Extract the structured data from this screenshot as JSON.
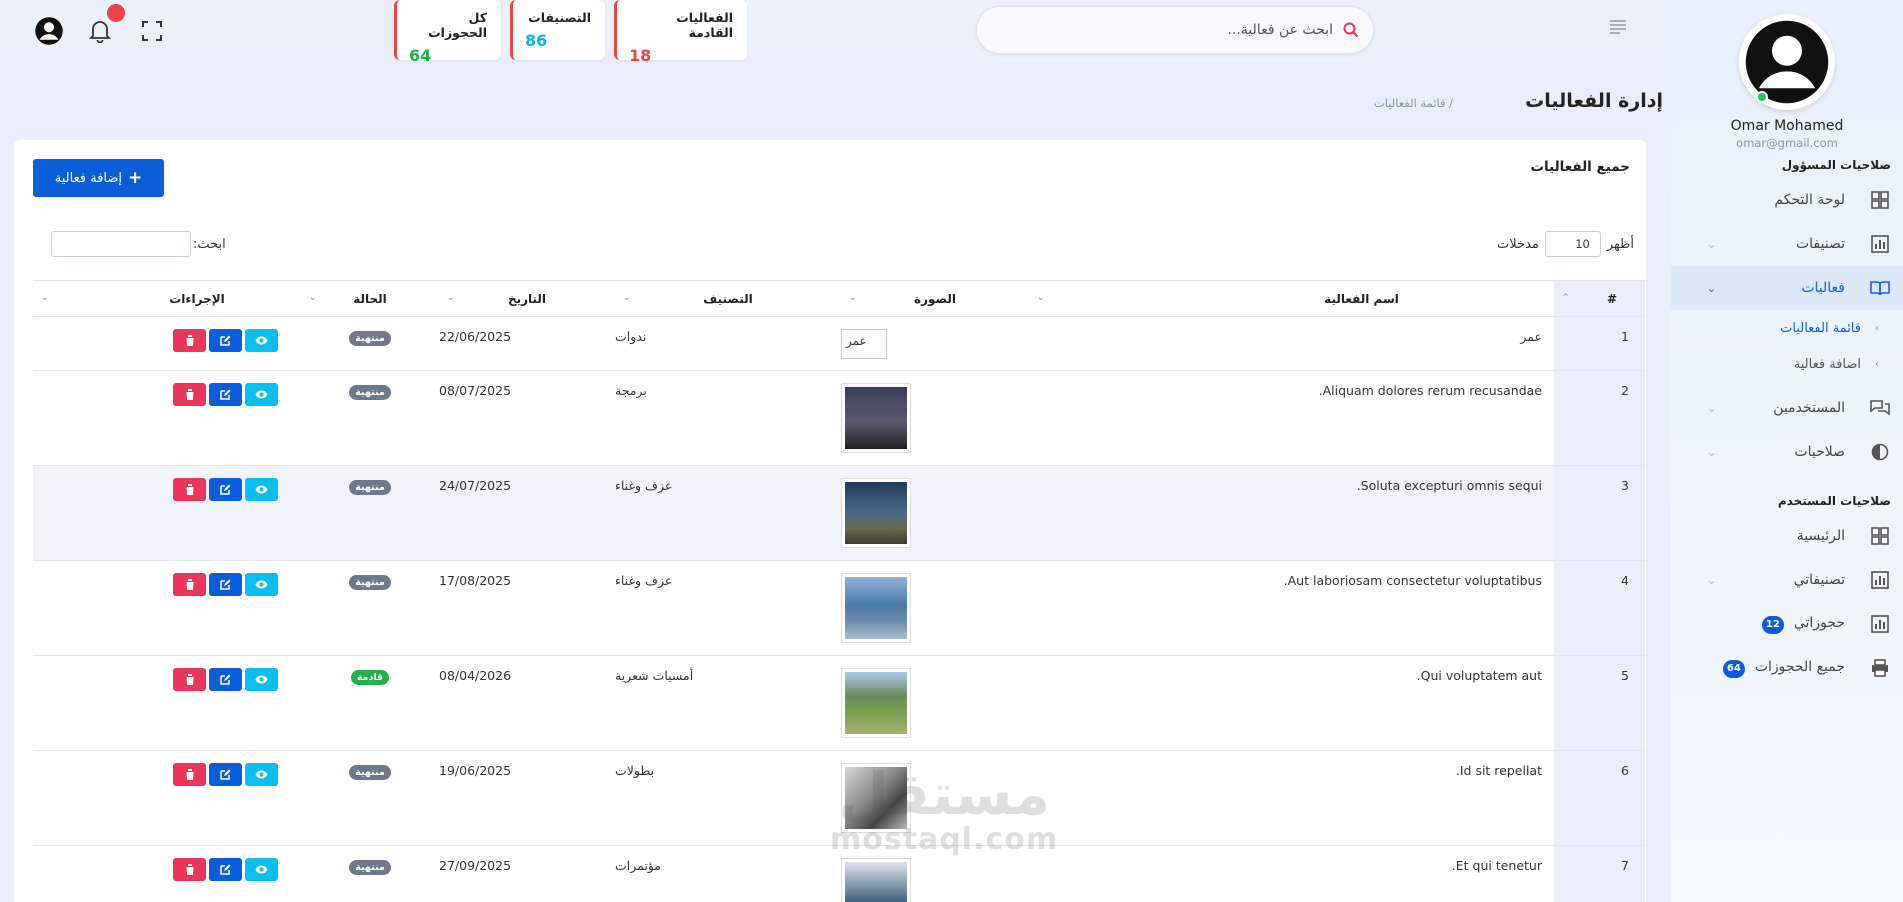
{
  "sidebar": {
    "user_name": "Omar Mohamed",
    "user_email": "omar@gmail.com",
    "admin_section": "صلاحيات المسؤول",
    "user_section": "صلاحيات المستخدم",
    "items": [
      {
        "label": "لوحة التحكم"
      },
      {
        "label": "تصنيفات"
      },
      {
        "label": "فعاليات"
      },
      {
        "label": "المستخدمين"
      },
      {
        "label": "صلاحيات"
      },
      {
        "label": "الرئيسية"
      },
      {
        "label": "تصنيفاتي"
      },
      {
        "label": "حجوزاتي",
        "badge": "12"
      },
      {
        "label": "جميع الحجوزات",
        "badge": "64"
      }
    ],
    "sub_items": [
      {
        "label": "قائمة الفعاليات"
      },
      {
        "label": "اضافة فعالية"
      }
    ]
  },
  "header": {
    "search_placeholder": "ابحث عن فعالية...",
    "stats": [
      {
        "label": "الفعاليات القادمة",
        "value": "18",
        "color": "#ef4444"
      },
      {
        "label": "التصنيفات",
        "value": "86",
        "color": "#0bb3ef"
      },
      {
        "label": "كل الحجوزات",
        "value": "64",
        "color": "#22b14c"
      }
    ]
  },
  "page": {
    "title": "إدارة الفعاليات",
    "breadcrumb": "/ قائمة الفعاليات"
  },
  "card": {
    "title": "جميع الفعاليات",
    "add_button": "إضافة فعالية",
    "show_label": "أظهر",
    "entries_value": "10",
    "entries_label": "مدخلات",
    "search_label": "ابحث:"
  },
  "table": {
    "headers": [
      "#",
      "اسم الفعالية",
      "الصورة",
      "التصنيف",
      "التاريخ",
      "الحالة",
      "الإجراءات"
    ],
    "rows": [
      {
        "num": "1",
        "name": "عمر",
        "img_alt": "عمر",
        "category": "ندوات",
        "date": "22/06/2025",
        "status": "منتهية"
      },
      {
        "num": "2",
        "name": "Aliquam dolores rerum recusandae.",
        "category": "برمجة",
        "date": "08/07/2025",
        "status": "منتهية"
      },
      {
        "num": "3",
        "name": "Soluta excepturi omnis sequi.",
        "category": "عزف وغناء",
        "date": "24/07/2025",
        "status": "منتهية"
      },
      {
        "num": "4",
        "name": "Aut laboriosam consectetur voluptatibus.",
        "category": "عزف وغناء",
        "date": "17/08/2025",
        "status": "منتهية"
      },
      {
        "num": "5",
        "name": "Qui voluptatem aut.",
        "category": "أمسيات شعرية",
        "date": "08/04/2026",
        "status": "قادمة"
      },
      {
        "num": "6",
        "name": "Id sit repellat.",
        "category": "بطولات",
        "date": "19/06/2025",
        "status": "منتهية"
      },
      {
        "num": "7",
        "name": "Et qui tenetur.",
        "category": "مؤتمرات",
        "date": "27/09/2025",
        "status": "منتهية"
      }
    ]
  },
  "watermark": {
    "line1": "مستقل",
    "line2": "mostaql.com"
  }
}
